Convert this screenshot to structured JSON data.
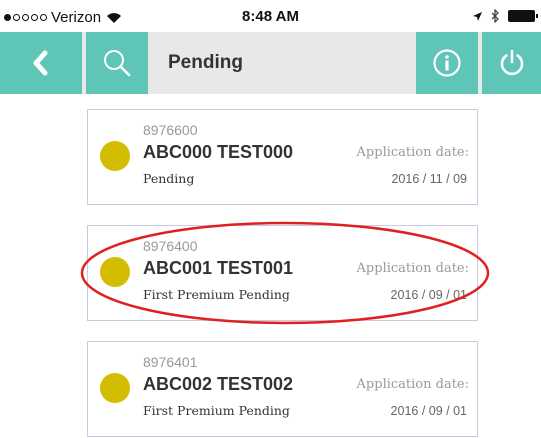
{
  "status_bar": {
    "carrier": "Verizon",
    "time": "8:48 AM",
    "signal_bars_filled": 1,
    "signal_bars_total": 5
  },
  "header": {
    "title": "Pending",
    "accent_color": "#5ec5b7",
    "buttons": [
      "back-icon",
      "search-icon",
      "info-icon",
      "power-icon"
    ]
  },
  "applications": [
    {
      "id": "8976600",
      "name": "ABC000 TEST000",
      "status": "Pending",
      "date_label": "Application date:",
      "date": "2016 / 11 / 09",
      "status_color": "#d4bd00"
    },
    {
      "id": "8976400",
      "name": "ABC001 TEST001",
      "status": "First Premium Pending",
      "date_label": "Application date:",
      "date": "2016 / 09 / 01",
      "status_color": "#d4bd00",
      "highlighted": true
    },
    {
      "id": "8976401",
      "name": "ABC002 TEST002",
      "status": "First Premium Pending",
      "date_label": "Application date:",
      "date": "2016 / 09 / 01",
      "status_color": "#d4bd00"
    }
  ],
  "annotation_color": "#e02020"
}
